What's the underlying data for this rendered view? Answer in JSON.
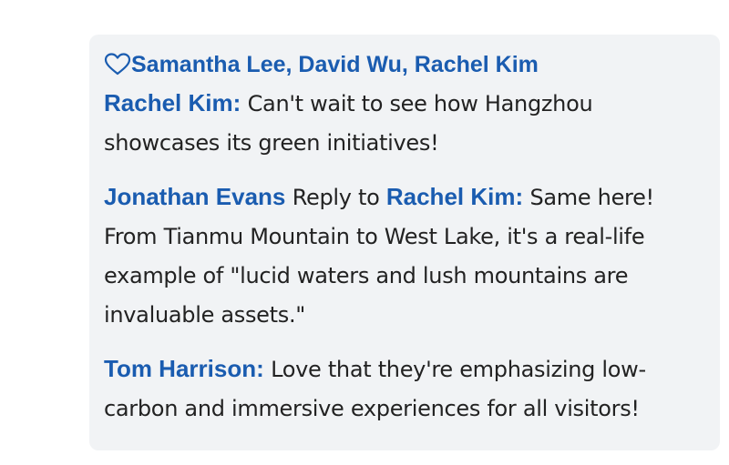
{
  "likes": {
    "icon": "heart-outline-icon",
    "names": "Samantha Lee, David Wu, Rachel Kim"
  },
  "comments": [
    {
      "author": "Rachel Kim:",
      "text": " Can't wait to see how Hangzhou showcases its green initiatives!"
    },
    {
      "author": "Jonathan Evans",
      "reply_label": " Reply to ",
      "reply_to": "Rachel Kim:",
      "text": " Same here! From Tianmu Mountain to West Lake, it's a real-life example of \"lucid waters and lush mountains are invaluable assets.\""
    },
    {
      "author": "Tom Harrison:",
      "text": " Love that they're emphasizing low-carbon and immersive experiences for all visitors!"
    }
  ],
  "colors": {
    "panel_bg": "#f1f3f5",
    "link": "#1a5cb0",
    "text": "#222222"
  }
}
